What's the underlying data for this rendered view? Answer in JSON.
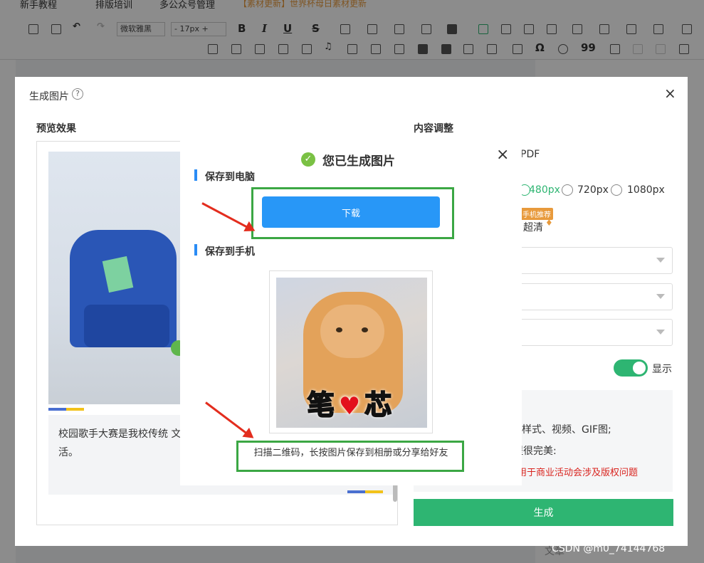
{
  "topnav": {
    "items": [
      "新手教程",
      "排版培训",
      "多公众号管理"
    ],
    "announcement": "【素材更新】世界杯母日素材更新"
  },
  "toolbar": {
    "font_family": "微软雅黑",
    "font_size": "17px",
    "size_minus": "-",
    "size_plus": "+",
    "bold": "B",
    "italic": "I",
    "underline": "U",
    "strike": "S",
    "omega": "Ω",
    "quote": "99"
  },
  "modal": {
    "title": "生成图片",
    "help_icon": "?",
    "close_icon": "×",
    "preview_label": "预览效果",
    "preview_text": "校园歌手大赛是我校传统 文化生活，营造积极向上 校学生的业余文化生活。",
    "adjust_label": "内容调整",
    "format_partial": "PDF",
    "resolutions": [
      "480px",
      "720px",
      "1080px"
    ],
    "selected_resolution": "480px",
    "recommend_badge": "手机推荐",
    "quality": "超清",
    "toggle_label": "显示",
    "note_line1": "动样式、视频、GIF图;",
    "note_line2": "提很完美:",
    "note_warning": "用于商业活动会涉及版权问题",
    "generate_button": "生成",
    "bottom_partial": "文章"
  },
  "popup": {
    "title": "您已生成图片",
    "close_icon": "×",
    "check_icon": "✓",
    "save_pc_label": "保存到电脑",
    "download_button": "下载",
    "save_mobile_label": "保存到手机",
    "qr_image_text_left": "笔",
    "qr_image_heart": "♥",
    "qr_image_text_right": "芯",
    "qr_caption": "扫描二维码，长按图片保存到相册或分享给好友"
  },
  "watermark": "CSDN @m0_74144768",
  "colors": {
    "primary_blue": "#2897f7",
    "green": "#2eb572",
    "annotation_green": "#3ba744",
    "arrow_red": "#e32d1e",
    "warning_red": "#d9241f"
  }
}
